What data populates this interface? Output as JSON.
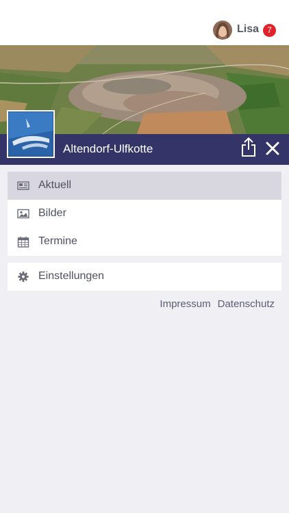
{
  "user": {
    "name": "Lisa",
    "notification_count": "7"
  },
  "header": {
    "site_name": "Altendorf-Ulfkotte"
  },
  "menu": {
    "main_items": [
      {
        "label": "Aktuell",
        "icon": "newspaper-icon",
        "active": true
      },
      {
        "label": "Bilder",
        "icon": "image-icon",
        "active": false
      },
      {
        "label": "Termine",
        "icon": "calendar-icon",
        "active": false
      }
    ],
    "settings_item": {
      "label": "Einstellungen",
      "icon": "gear-icon"
    }
  },
  "footer": {
    "impressum": "Impressum",
    "datenschutz": "Datenschutz"
  },
  "colors": {
    "accent": "#343468",
    "badge": "#e0222b",
    "background": "#efeff4",
    "active_row": "#d8d7df"
  }
}
